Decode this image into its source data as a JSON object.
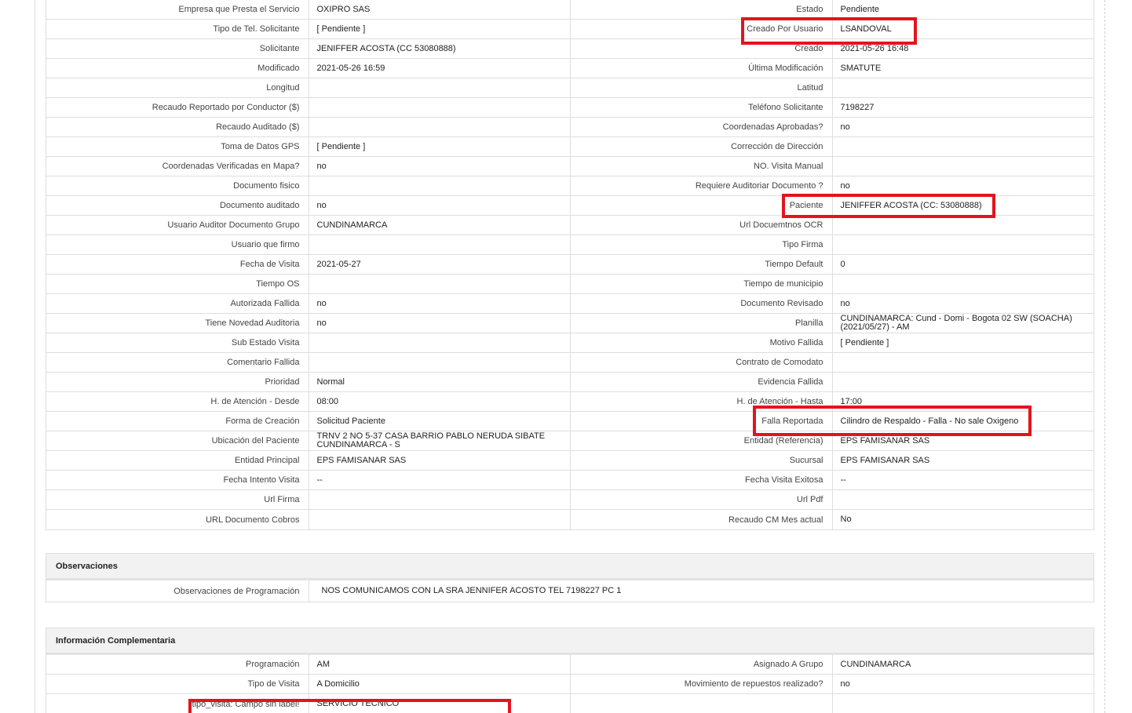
{
  "rows": [
    {
      "l1": "Empresa que Presta el Servicio",
      "v1": "OXIPRO SAS",
      "l2": "Estado",
      "v2": "Pendiente"
    },
    {
      "l1": "Tipo de Tel. Solicitante",
      "v1": "[ Pendiente ]",
      "l2": "Creado Por Usuario",
      "v2": "LSANDOVAL"
    },
    {
      "l1": "Solicitante",
      "v1": "JENIFFER ACOSTA (CC 53080888)",
      "l2": "Creado",
      "v2": "2021-05-26 16:48"
    },
    {
      "l1": "Modificado",
      "v1": "2021-05-26 16:59",
      "l2": "Última Modificación",
      "v2": " SMATUTE"
    },
    {
      "l1": "Longitud",
      "v1": "",
      "l2": "Latitud",
      "v2": ""
    },
    {
      "l1": "Recaudo Reportado por Conductor ($)",
      "v1": "",
      "l2": "Teléfono Solicitante",
      "v2": "7198227"
    },
    {
      "l1": "Recaudo Auditado ($)",
      "v1": "",
      "l2": "Coordenadas Aprobadas?",
      "v2": " no"
    },
    {
      "l1": "Toma de Datos GPS",
      "v1": "[ Pendiente ]",
      "l2": "Corrección de Dirección",
      "v2": ""
    },
    {
      "l1": "Coordenadas Verificadas en Mapa?",
      "v1": " no",
      "l2": "NO. Visita Manual",
      "v2": ""
    },
    {
      "l1": "Documento fisico",
      "v1": "",
      "l2": "Requiere Auditoriar Documento ?",
      "v2": " no"
    },
    {
      "l1": "Documento auditado",
      "v1": " no",
      "l2": "Paciente",
      "v2": "JENIFFER ACOSTA (CC: 53080888)"
    },
    {
      "l1": "Usuario Auditor Documento Grupo",
      "v1": "CUNDINAMARCA",
      "l2": "Url Docuemtnos OCR",
      "v2": ""
    },
    {
      "l1": "Usuario que firmo",
      "v1": "",
      "l2": "Tipo Firma",
      "v2": ""
    },
    {
      "l1": "Fecha de Visita",
      "v1": " 2021-05-27",
      "l2": "Tiempo Default",
      "v2": "0"
    },
    {
      "l1": "Tiempo OS",
      "v1": "",
      "l2": "Tiempo de municipio",
      "v2": ""
    },
    {
      "l1": "Autorizada Fallida",
      "v1": " no",
      "l2": "Documento Revisado",
      "v2": " no"
    },
    {
      "l1": "Tiene Novedad Auditoria",
      "v1": " no",
      "l2": "Planilla",
      "v2": "CUNDINAMARCA: Cund - Domi - Bogota 02 SW (SOACHA) (2021/05/27) - AM"
    },
    {
      "l1": "Sub Estado Visita",
      "v1": "",
      "l2": "Motivo Fallida",
      "v2": "[ Pendiente ]"
    },
    {
      "l1": "Comentario Fallida",
      "v1": "",
      "l2": "Contrato de Comodato",
      "v2": ""
    },
    {
      "l1": "Prioridad",
      "v1": "Normal",
      "l2": "Evidencia Fallida",
      "v2": ""
    },
    {
      "l1": "H. de Atención - Desde",
      "v1": "08:00",
      "l2": "H. de Atención - Hasta",
      "v2": "17:00"
    },
    {
      "l1": "Forma de Creación",
      "v1": "Solicitud Paciente",
      "l2": "Falla Reportada",
      "v2": "Cilindro de Respaldo - Falla - No sale Oxigeno"
    },
    {
      "l1": "Ubicación del Paciente",
      "v1": "TRNV 2 NO 5-37 CASA BARRIO PABLO NERUDA SIBATE CUNDINAMARCA - S",
      "l2": "Entidad (Referencia)",
      "v2": "EPS FAMISANAR SAS"
    },
    {
      "l1": "Entidad Principal",
      "v1": "EPS FAMISANAR SAS",
      "l2": "Sucursal",
      "v2": "EPS FAMISANAR SAS"
    },
    {
      "l1": "Fecha Intento Visita",
      "v1": " --",
      "l2": "Fecha Visita Exitosa",
      "v2": " --"
    },
    {
      "l1": "Url Firma",
      "v1": "",
      "l2": "Url Pdf",
      "v2": ""
    },
    {
      "l1": "URL Documento Cobros",
      "v1": "",
      "l2": "Recaudo CM Mes actual",
      "v2": "No"
    }
  ],
  "observaciones": {
    "title": "Observaciones",
    "label": "Observaciones de Programación",
    "value": "NOS COMUNICAMOS CON LA SRA JENNIFER ACOSTO TEL 7198227 PC 1"
  },
  "complementaria": {
    "title": "Información Complementaria",
    "rows": [
      {
        "l1": "Programación",
        "v1": "AM",
        "l2": "Asignado A Grupo",
        "v2": "CUNDINAMARCA"
      },
      {
        "l1": "Tipo de Visita",
        "v1": "A Domicilio",
        "l2": "Movimiento de repuestos realizado?",
        "v2": " no"
      },
      {
        "l1": "tipo_visita: Campo sin label!",
        "v1": "SERVICIO TECNICO",
        "l2": "",
        "v2": ""
      }
    ]
  },
  "highlight_color": "#e3141c"
}
